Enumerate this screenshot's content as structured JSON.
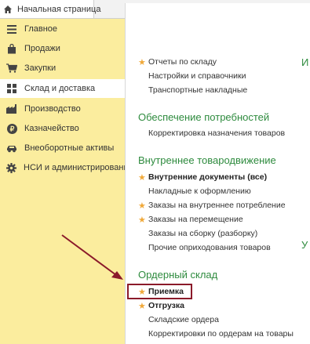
{
  "tab": {
    "home_label": "Начальная страница"
  },
  "sidebar": {
    "items": [
      {
        "label": "Главное",
        "icon": "menu-lines-icon"
      },
      {
        "label": "Продажи",
        "icon": "shopping-bag-icon"
      },
      {
        "label": "Закупки",
        "icon": "cart-icon"
      },
      {
        "label": "Склад и доставка",
        "icon": "warehouse-grid-icon",
        "active": true
      },
      {
        "label": "Производство",
        "icon": "factory-icon"
      },
      {
        "label": "Казначейство",
        "icon": "coin-icon"
      },
      {
        "label": "Внеоборотные активы",
        "icon": "car-icon"
      },
      {
        "label": "НСИ и администрирование",
        "icon": "gear-icon"
      }
    ]
  },
  "main": {
    "group1": [
      {
        "label": "Отчеты по складу",
        "starred": true
      },
      {
        "label": "Настройки и справочники",
        "starred": false
      },
      {
        "label": "Транспортные накладные",
        "starred": false
      }
    ],
    "section2": {
      "heading": "Обеспечение потребностей",
      "items": [
        {
          "label": "Корректировка назначения товаров",
          "starred": false
        }
      ]
    },
    "section3": {
      "heading": "Внутреннее товародвижение",
      "items": [
        {
          "label": "Внутренние документы (все)",
          "starred": true,
          "bold": true
        },
        {
          "label": "Накладные к оформлению",
          "starred": false
        },
        {
          "label": "Заказы на внутреннее потребление",
          "starred": true
        },
        {
          "label": "Заказы на перемещение",
          "starred": true
        },
        {
          "label": "Заказы на сборку (разборку)",
          "starred": false
        },
        {
          "label": "Прочие оприходования товаров",
          "starred": false
        }
      ]
    },
    "section4": {
      "heading": "Ордерный склад",
      "items": [
        {
          "label": "Приемка",
          "starred": true,
          "bold": true,
          "highlighted": true
        },
        {
          "label": "Отгрузка",
          "starred": true,
          "bold": true
        },
        {
          "label": "Складские ордера",
          "starred": false
        },
        {
          "label": "Корректировки по ордерам на товары",
          "starred": false
        }
      ]
    },
    "right_fragments": [
      "И",
      "У"
    ]
  },
  "colors": {
    "sidebar_bg": "#fbed9e",
    "heading_green": "#2e8b3e",
    "star_orange": "#f0a93a",
    "highlight_border": "#8b1a2a",
    "arrow": "#8b1a2a"
  }
}
